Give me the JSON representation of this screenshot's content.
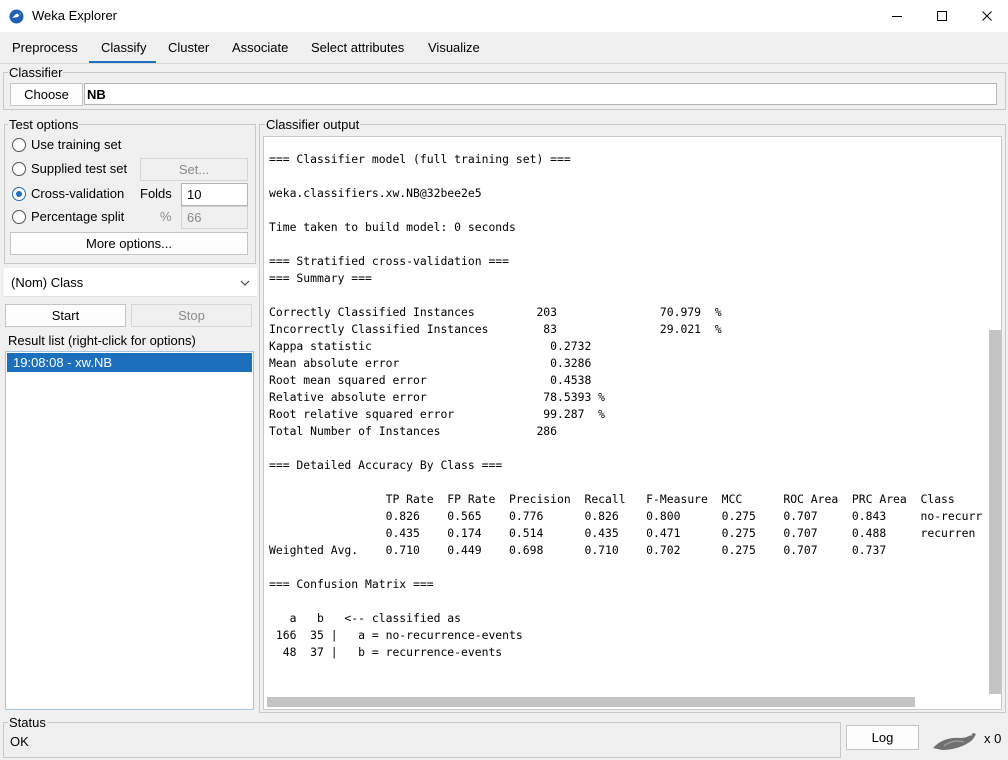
{
  "window": {
    "title": "Weka Explorer"
  },
  "tabs": [
    "Preprocess",
    "Classify",
    "Cluster",
    "Associate",
    "Select attributes",
    "Visualize"
  ],
  "active_tab": "Classify",
  "classifier": {
    "section_label": "Classifier",
    "choose_label": "Choose",
    "value": "NB"
  },
  "test_options": {
    "section_label": "Test options",
    "use_training_set": "Use training set",
    "supplied_test_set": "Supplied test set",
    "set_button": "Set...",
    "cross_validation": "Cross-validation",
    "folds_label": "Folds",
    "folds_value": "10",
    "percentage_split": "Percentage split",
    "percent_symbol": "%",
    "percent_value": "66",
    "more_options": "More options...",
    "selected": "Cross-validation"
  },
  "class_select": {
    "value": "(Nom) Class"
  },
  "actions": {
    "start": "Start",
    "stop": "Stop"
  },
  "result_list": {
    "label": "Result list (right-click for options)",
    "items": [
      "19:08:08 - xw.NB"
    ]
  },
  "output": {
    "label": "Classifier output",
    "lines": [
      "=== Classifier model (full training set) ===",
      "",
      "weka.classifiers.xw.NB@32bee2e5",
      "",
      "Time taken to build model: 0 seconds",
      "",
      "=== Stratified cross-validation ===",
      "=== Summary ===",
      "",
      "Correctly Classified Instances         203               70.979  %",
      "Incorrectly Classified Instances        83               29.021  %",
      "Kappa statistic                          0.2732",
      "Mean absolute error                      0.3286",
      "Root mean squared error                  0.4538",
      "Relative absolute error                 78.5393 %",
      "Root relative squared error             99.287  %",
      "Total Number of Instances              286",
      "",
      "=== Detailed Accuracy By Class ===",
      "",
      "                 TP Rate  FP Rate  Precision  Recall   F-Measure  MCC      ROC Area  PRC Area  Class",
      "                 0.826    0.565    0.776      0.826    0.800      0.275    0.707     0.843     no-recurr",
      "                 0.435    0.174    0.514      0.435    0.471      0.275    0.707     0.488     recurren",
      "Weighted Avg.    0.710    0.449    0.698      0.710    0.702      0.275    0.707     0.737",
      "",
      "=== Confusion Matrix ===",
      "",
      "   a   b   <-- classified as",
      " 166  35 |   a = no-recurrence-events",
      "  48  37 |   b = recurrence-events"
    ]
  },
  "status": {
    "label": "Status",
    "text": "OK",
    "log_button": "Log",
    "count": "x 0"
  }
}
